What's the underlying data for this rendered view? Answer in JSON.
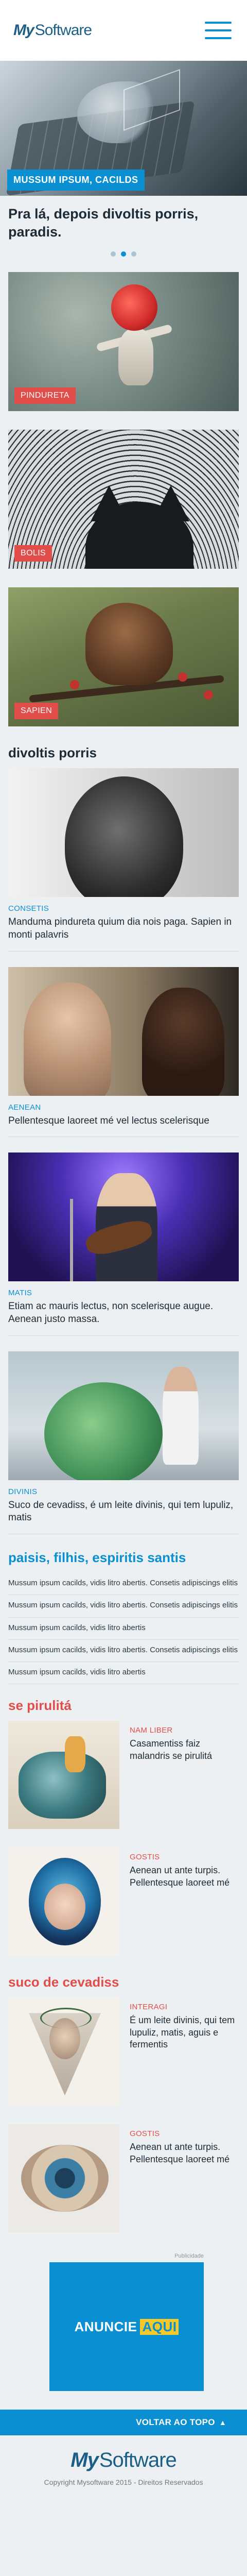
{
  "header": {
    "logo_my": "My",
    "logo_software": "Software",
    "menu_icon": "hamburger-menu-icon"
  },
  "hero": {
    "tag": "MUSSUM IPSUM, CACILDS",
    "title": "Pra lá, depois divoltis porris, paradis.",
    "slides": 3,
    "active_slide": 1
  },
  "featured": [
    {
      "badge": "PINDURETA"
    },
    {
      "badge": "BOLIS"
    },
    {
      "badge": "SAPIEN"
    }
  ],
  "section1": {
    "title": "divoltis porris",
    "items": [
      {
        "category": "CONSETIS",
        "text": "Manduma pindureta quium dia nois paga. Sapien in monti palavris"
      },
      {
        "category": "AENEAN",
        "text": "Pellentesque laoreet mé vel lectus scelerisque"
      },
      {
        "category": "MATIS",
        "text": "Etiam ac mauris lectus, non scelerisque augue. Aenean justo massa."
      },
      {
        "category": "DIVINIS",
        "text": "Suco de cevadiss, é um leite divinis, qui tem lupuliz, matis"
      }
    ]
  },
  "section2": {
    "title": "paisis, filhis, espiritis santis",
    "links": [
      "Mussum ipsum cacilds, vidis litro abertis. Consetis adipiscings elitis",
      "Mussum ipsum cacilds, vidis litro abertis. Consetis adipiscings elitis",
      "Mussum ipsum cacilds, vidis litro abertis",
      "Mussum ipsum cacilds, vidis litro abertis. Consetis adipiscings elitis",
      "Mussum ipsum cacilds, vidis litro abertis"
    ]
  },
  "section3": {
    "title": "se pirulitá",
    "items": [
      {
        "category": "NAM LIBER",
        "text": "Casamentiss faiz malandris se pirulitá"
      },
      {
        "category": "GOSTIS",
        "text": "Aenean ut ante turpis. Pellentesque laoreet mé"
      }
    ]
  },
  "section4": {
    "title": "suco de cevadiss",
    "items": [
      {
        "category": "INTERAGI",
        "text": "É um leite divinis, qui tem lupuliz, matis, aguis e fermentis"
      },
      {
        "category": "GOSTIS",
        "text": "Aenean ut ante turpis. Pellentesque laoreet mé"
      }
    ]
  },
  "ad": {
    "label": "Publicidade",
    "text": "ANUNCIE",
    "highlight": "AQUI"
  },
  "back_to_top": {
    "label": "VOLTAR AO TOPO",
    "icon": "arrow-up-icon"
  },
  "footer": {
    "logo_my": "My",
    "logo_software": "Software",
    "copyright": "Copyright Mysoftware 2015 - Direitos Reservados"
  },
  "colors": {
    "brand_blue": "#0b8fd3",
    "brand_dark": "#1c5f86",
    "accent_red": "#e14e4a",
    "background": "#edf0f2"
  }
}
